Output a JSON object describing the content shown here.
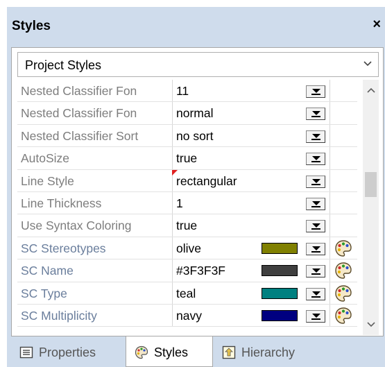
{
  "panel": {
    "title": "Styles",
    "close_glyph": "×"
  },
  "dropdown": {
    "selected": "Project Styles"
  },
  "rows": [
    {
      "name": "Nested Classifier Fon",
      "value": "11",
      "sc": false
    },
    {
      "name": "Nested Classifier Fon",
      "value": "normal",
      "sc": false
    },
    {
      "name": "Nested Classifier Sort",
      "value": "no sort",
      "sc": false
    },
    {
      "name": "AutoSize",
      "value": "true",
      "sc": false
    },
    {
      "name": "Line Style",
      "value": "rectangular",
      "sc": false,
      "flag": true
    },
    {
      "name": "Line Thickness",
      "value": "1",
      "sc": false
    },
    {
      "name": "Use Syntax Coloring",
      "value": "true",
      "sc": false
    },
    {
      "name": "SC Stereotypes",
      "value": "olive",
      "sc": true,
      "color": "#808000"
    },
    {
      "name": "SC Name",
      "value": "#3F3F3F",
      "sc": true,
      "color": "#3F3F3F"
    },
    {
      "name": "SC Type",
      "value": "teal",
      "sc": true,
      "color": "#008080"
    },
    {
      "name": "SC Multiplicity",
      "value": "navy",
      "sc": true,
      "color": "#000080"
    }
  ],
  "tabs": [
    {
      "label": "Properties",
      "icon": "list-icon",
      "active": false
    },
    {
      "label": "Styles",
      "icon": "palette-icon",
      "active": true
    },
    {
      "label": "Hierarchy",
      "icon": "hierarchy-icon",
      "active": false
    }
  ]
}
